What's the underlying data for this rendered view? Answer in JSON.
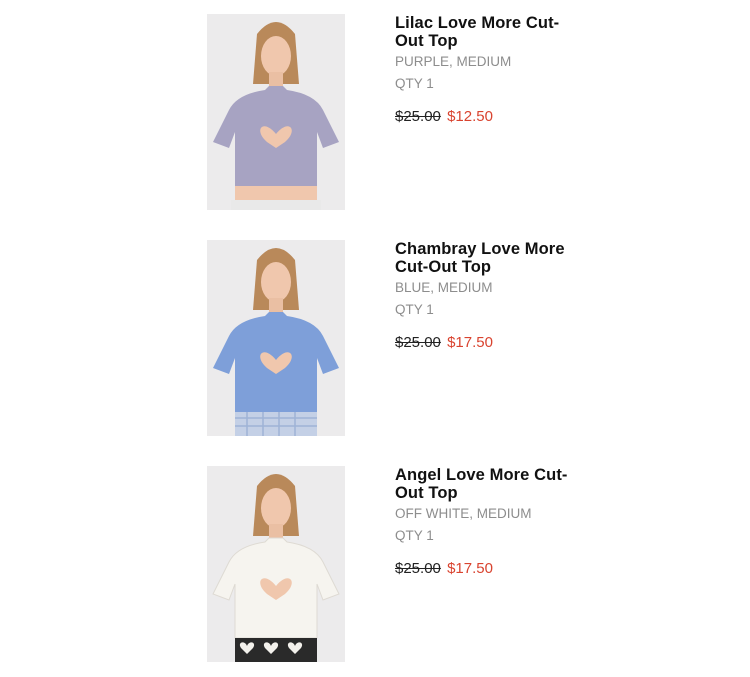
{
  "cart": {
    "items": [
      {
        "title": "Lilac Love More Cut-Out Top",
        "variant": "PURPLE, MEDIUM",
        "qty": "QTY 1",
        "original_price": "$25.00",
        "sale_price": "$12.50",
        "top_color": "#a7a3c2",
        "bottom_color": "#e9e9e9"
      },
      {
        "title": "Chambray Love More Cut-Out Top",
        "variant": "BLUE, MEDIUM",
        "qty": "QTY 1",
        "original_price": "$25.00",
        "sale_price": "$17.50",
        "top_color": "#7e9fd9",
        "bottom_color": "#c4d0e6"
      },
      {
        "title": "Angel Love More Cut-Out Top",
        "variant": "OFF WHITE, MEDIUM",
        "qty": "QTY 1",
        "original_price": "$25.00",
        "sale_price": "$17.50",
        "top_color": "#f6f4ef",
        "bottom_color": "#2a2a2a"
      }
    ]
  },
  "colors": {
    "sale": "#d9432f",
    "muted": "#8d8d8d",
    "title": "#111111"
  }
}
